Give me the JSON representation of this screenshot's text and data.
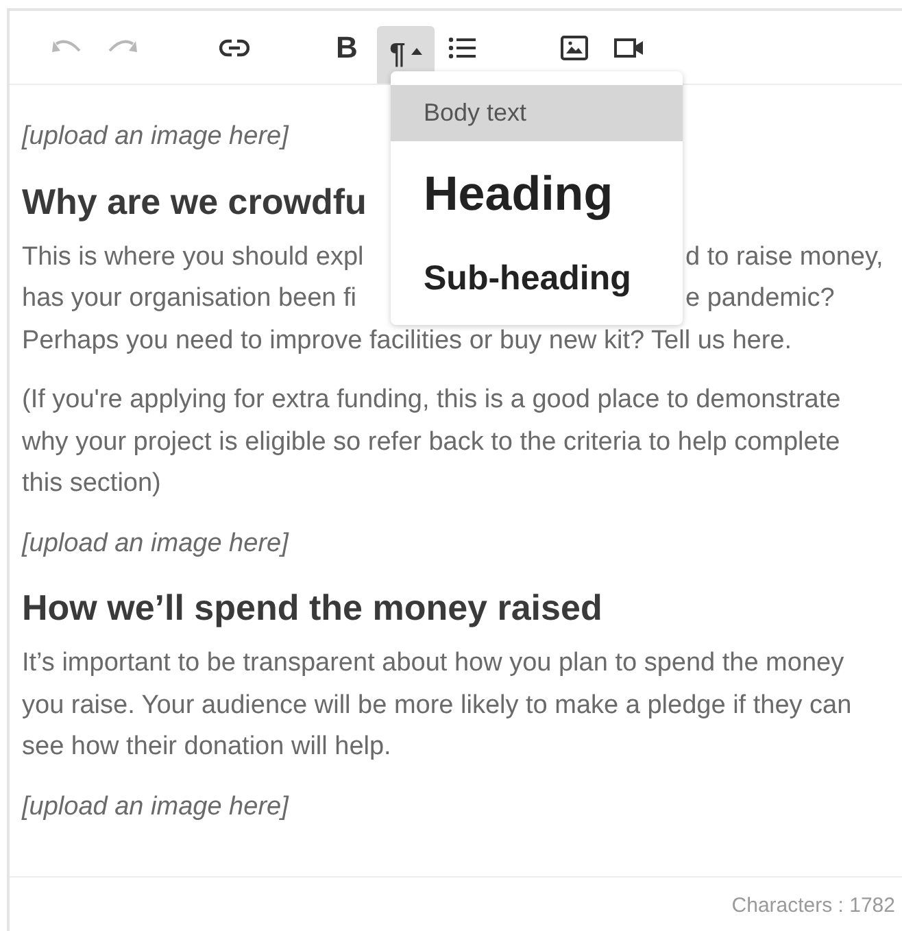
{
  "toolbar": {
    "buttons": [
      {
        "kind": "undo",
        "disabled": true
      },
      {
        "kind": "redo",
        "disabled": true
      },
      {
        "kind": "link",
        "disabled": false
      },
      {
        "kind": "bold",
        "label": "B",
        "disabled": false
      },
      {
        "kind": "paragraph",
        "label": "¶",
        "disabled": false
      },
      {
        "kind": "list",
        "disabled": false
      },
      {
        "kind": "image",
        "disabled": false
      },
      {
        "kind": "video",
        "disabled": false
      }
    ]
  },
  "style_menu": {
    "open": true,
    "items": [
      {
        "kind": "body",
        "label": "Body text",
        "selected": true
      },
      {
        "kind": "heading",
        "label": "Heading",
        "selected": false
      },
      {
        "kind": "subheading",
        "label": "Sub-heading",
        "selected": false
      }
    ]
  },
  "content": [
    {
      "kind": "cut"
    },
    {
      "kind": "placeholder",
      "text": "[upload an image here]"
    },
    {
      "kind": "heading",
      "text": "Why are we crowdfu"
    },
    {
      "kind": "split",
      "lines": [
        [
          "This is where you should expl",
          "d to raise money,"
        ],
        [
          "has your organisation been fi",
          "e pandemic?"
        ],
        [
          "Perhaps you need to improve facilities or buy new kit? Tell us here."
        ]
      ]
    },
    {
      "kind": "paragraph",
      "text": "(If you're applying for extra funding, this is a good place to demonstrate why your project is eligible so refer back to the criteria to help complete this section)"
    },
    {
      "kind": "placeholder",
      "text": "[upload an image here]"
    },
    {
      "kind": "heading",
      "text": "How we’ll spend the money raised"
    },
    {
      "kind": "paragraph",
      "text": "It’s important to be transparent about how you plan to spend the money you raise. Your audience will be more likely to make a pledge if they can see how their donation will help."
    },
    {
      "kind": "placeholder",
      "text": "[upload an image here]"
    }
  ],
  "footer": {
    "character_count": "Characters : 1782"
  }
}
